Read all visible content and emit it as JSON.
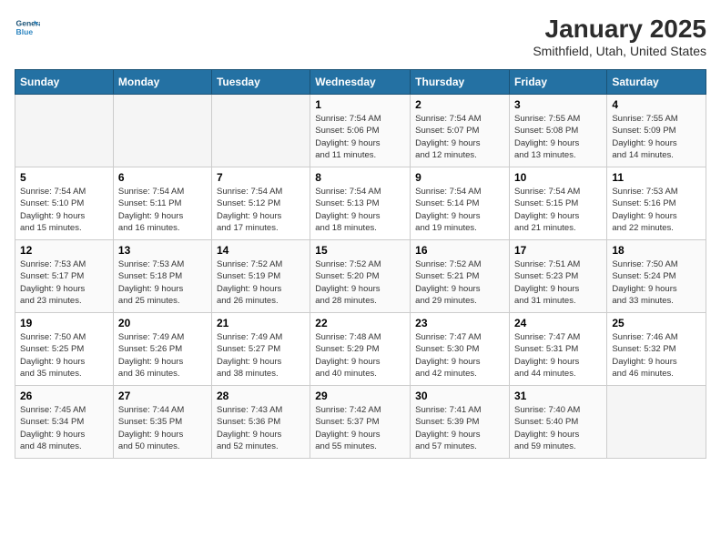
{
  "logo": {
    "line1": "General",
    "line2": "Blue"
  },
  "title": "January 2025",
  "location": "Smithfield, Utah, United States",
  "weekdays": [
    "Sunday",
    "Monday",
    "Tuesday",
    "Wednesday",
    "Thursday",
    "Friday",
    "Saturday"
  ],
  "weeks": [
    [
      {
        "day": "",
        "info": ""
      },
      {
        "day": "",
        "info": ""
      },
      {
        "day": "",
        "info": ""
      },
      {
        "day": "1",
        "info": "Sunrise: 7:54 AM\nSunset: 5:06 PM\nDaylight: 9 hours\nand 11 minutes."
      },
      {
        "day": "2",
        "info": "Sunrise: 7:54 AM\nSunset: 5:07 PM\nDaylight: 9 hours\nand 12 minutes."
      },
      {
        "day": "3",
        "info": "Sunrise: 7:55 AM\nSunset: 5:08 PM\nDaylight: 9 hours\nand 13 minutes."
      },
      {
        "day": "4",
        "info": "Sunrise: 7:55 AM\nSunset: 5:09 PM\nDaylight: 9 hours\nand 14 minutes."
      }
    ],
    [
      {
        "day": "5",
        "info": "Sunrise: 7:54 AM\nSunset: 5:10 PM\nDaylight: 9 hours\nand 15 minutes."
      },
      {
        "day": "6",
        "info": "Sunrise: 7:54 AM\nSunset: 5:11 PM\nDaylight: 9 hours\nand 16 minutes."
      },
      {
        "day": "7",
        "info": "Sunrise: 7:54 AM\nSunset: 5:12 PM\nDaylight: 9 hours\nand 17 minutes."
      },
      {
        "day": "8",
        "info": "Sunrise: 7:54 AM\nSunset: 5:13 PM\nDaylight: 9 hours\nand 18 minutes."
      },
      {
        "day": "9",
        "info": "Sunrise: 7:54 AM\nSunset: 5:14 PM\nDaylight: 9 hours\nand 19 minutes."
      },
      {
        "day": "10",
        "info": "Sunrise: 7:54 AM\nSunset: 5:15 PM\nDaylight: 9 hours\nand 21 minutes."
      },
      {
        "day": "11",
        "info": "Sunrise: 7:53 AM\nSunset: 5:16 PM\nDaylight: 9 hours\nand 22 minutes."
      }
    ],
    [
      {
        "day": "12",
        "info": "Sunrise: 7:53 AM\nSunset: 5:17 PM\nDaylight: 9 hours\nand 23 minutes."
      },
      {
        "day": "13",
        "info": "Sunrise: 7:53 AM\nSunset: 5:18 PM\nDaylight: 9 hours\nand 25 minutes."
      },
      {
        "day": "14",
        "info": "Sunrise: 7:52 AM\nSunset: 5:19 PM\nDaylight: 9 hours\nand 26 minutes."
      },
      {
        "day": "15",
        "info": "Sunrise: 7:52 AM\nSunset: 5:20 PM\nDaylight: 9 hours\nand 28 minutes."
      },
      {
        "day": "16",
        "info": "Sunrise: 7:52 AM\nSunset: 5:21 PM\nDaylight: 9 hours\nand 29 minutes."
      },
      {
        "day": "17",
        "info": "Sunrise: 7:51 AM\nSunset: 5:23 PM\nDaylight: 9 hours\nand 31 minutes."
      },
      {
        "day": "18",
        "info": "Sunrise: 7:50 AM\nSunset: 5:24 PM\nDaylight: 9 hours\nand 33 minutes."
      }
    ],
    [
      {
        "day": "19",
        "info": "Sunrise: 7:50 AM\nSunset: 5:25 PM\nDaylight: 9 hours\nand 35 minutes."
      },
      {
        "day": "20",
        "info": "Sunrise: 7:49 AM\nSunset: 5:26 PM\nDaylight: 9 hours\nand 36 minutes."
      },
      {
        "day": "21",
        "info": "Sunrise: 7:49 AM\nSunset: 5:27 PM\nDaylight: 9 hours\nand 38 minutes."
      },
      {
        "day": "22",
        "info": "Sunrise: 7:48 AM\nSunset: 5:29 PM\nDaylight: 9 hours\nand 40 minutes."
      },
      {
        "day": "23",
        "info": "Sunrise: 7:47 AM\nSunset: 5:30 PM\nDaylight: 9 hours\nand 42 minutes."
      },
      {
        "day": "24",
        "info": "Sunrise: 7:47 AM\nSunset: 5:31 PM\nDaylight: 9 hours\nand 44 minutes."
      },
      {
        "day": "25",
        "info": "Sunrise: 7:46 AM\nSunset: 5:32 PM\nDaylight: 9 hours\nand 46 minutes."
      }
    ],
    [
      {
        "day": "26",
        "info": "Sunrise: 7:45 AM\nSunset: 5:34 PM\nDaylight: 9 hours\nand 48 minutes."
      },
      {
        "day": "27",
        "info": "Sunrise: 7:44 AM\nSunset: 5:35 PM\nDaylight: 9 hours\nand 50 minutes."
      },
      {
        "day": "28",
        "info": "Sunrise: 7:43 AM\nSunset: 5:36 PM\nDaylight: 9 hours\nand 52 minutes."
      },
      {
        "day": "29",
        "info": "Sunrise: 7:42 AM\nSunset: 5:37 PM\nDaylight: 9 hours\nand 55 minutes."
      },
      {
        "day": "30",
        "info": "Sunrise: 7:41 AM\nSunset: 5:39 PM\nDaylight: 9 hours\nand 57 minutes."
      },
      {
        "day": "31",
        "info": "Sunrise: 7:40 AM\nSunset: 5:40 PM\nDaylight: 9 hours\nand 59 minutes."
      },
      {
        "day": "",
        "info": ""
      }
    ]
  ]
}
